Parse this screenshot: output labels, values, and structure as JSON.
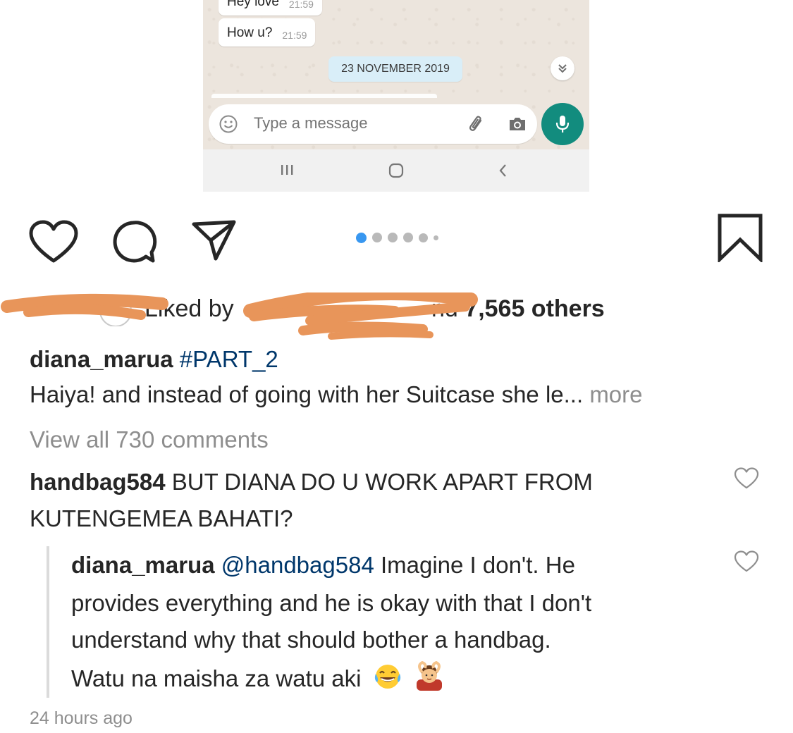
{
  "chat": {
    "messages": [
      {
        "text": "Hey love",
        "time": "21:59"
      },
      {
        "text": "How u?",
        "time": "21:59"
      }
    ],
    "date_separator": "23 NOVEMBER 2019",
    "input_placeholder": "Type a message",
    "accent": "#128c7e"
  },
  "post": {
    "likes": {
      "prefix": "Liked by",
      "suffix": "nd",
      "count": "7,565 others"
    },
    "caption": {
      "username": "diana_marua",
      "hashtag": "#PART_2",
      "text": "Haiya! and instead of going with her Suitcase she le...",
      "more": "more"
    },
    "view_all": "View all 730 comments",
    "comments": [
      {
        "username": "handbag584",
        "line1": "BUT DIANA DO U WORK APART FROM",
        "line2": "KUTENGEMEA BAHATI?"
      }
    ],
    "reply": {
      "username": "diana_marua",
      "mention": "@handbag584",
      "line1": "Imagine I don't. He",
      "line2": "provides everything and he is okay with that I don't",
      "line3": "understand why that should bother a handbag.",
      "line4": "Watu na maisha za watu aki"
    },
    "timestamp": "24 hours ago",
    "carousel": {
      "count": 6,
      "active_index": 0
    },
    "colors": {
      "link": "#00376b",
      "muted": "#8e8e8e",
      "dot_active": "#3897f0",
      "redaction": "#e8955a"
    }
  }
}
